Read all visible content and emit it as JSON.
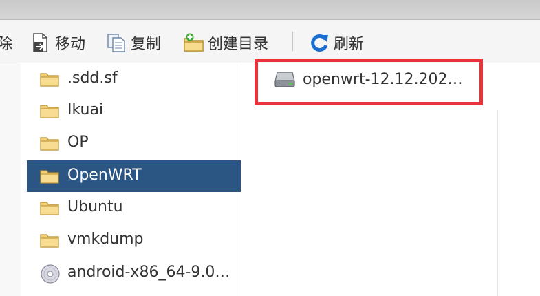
{
  "toolbar": {
    "delete_label": "除",
    "move_label": "移动",
    "copy_label": "复制",
    "mkdir_label": "创建目录",
    "refresh_label": "刷新"
  },
  "folders": [
    {
      "name": ".sdd.sf",
      "icon": "folder-icon"
    },
    {
      "name": "Ikuai",
      "icon": "folder-icon"
    },
    {
      "name": "OP",
      "icon": "folder-icon"
    },
    {
      "name": "OpenWRT",
      "icon": "folder-icon",
      "selected": true
    },
    {
      "name": "Ubuntu",
      "icon": "folder-icon"
    },
    {
      "name": "vmkdump",
      "icon": "folder-icon"
    },
    {
      "name": "android-x86_64-9.0…",
      "icon": "disc-icon"
    }
  ],
  "files": [
    {
      "name": "openwrt-12.12.202…",
      "icon": "disk-image-icon"
    }
  ],
  "colors": {
    "selection": "#2b5583",
    "highlight_box": "#e8333b",
    "folder_yellow": "#f2d27a"
  }
}
